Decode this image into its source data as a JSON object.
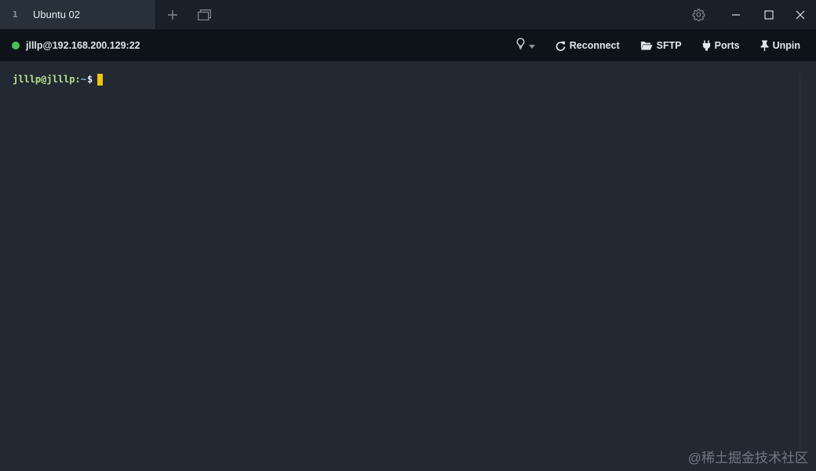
{
  "tabs": [
    {
      "index": "1",
      "title": "Ubuntu 02"
    }
  ],
  "session": {
    "connection": "jlllp@192.168.200.129:22",
    "status_color": "#4fbf55",
    "actions": {
      "reconnect": "Reconnect",
      "sftp": "SFTP",
      "ports": "Ports",
      "unpin": "Unpin"
    }
  },
  "terminal": {
    "prompt_user": "jlllp@jlllp",
    "prompt_sep": ":",
    "prompt_path": "~",
    "prompt_symbol": "$",
    "cursor_color": "#f2c20c"
  },
  "watermark": "@稀土掘金技术社区",
  "icons": {
    "new_tab": "plus-icon",
    "tab_overview": "windows-icon",
    "settings": "gear-icon",
    "minimize": "minimize-icon",
    "maximize": "maximize-icon",
    "close": "close-icon",
    "bulb": "lightbulb-icon",
    "reconnect": "reload-icon",
    "sftp": "folder-open-icon",
    "ports": "plug-icon",
    "unpin": "pin-icon"
  }
}
